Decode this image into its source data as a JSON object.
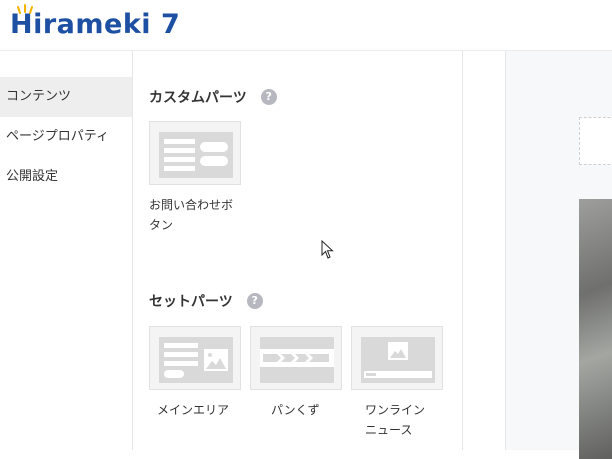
{
  "header": {
    "logo_text": "Hirameki 7"
  },
  "sidebar": {
    "items": [
      {
        "label": "コンテンツ",
        "active": true
      },
      {
        "label": "ページプロパティ",
        "active": false
      },
      {
        "label": "公開設定",
        "active": false
      }
    ]
  },
  "panel": {
    "custom_parts": {
      "title": "カスタムパーツ",
      "help": "?",
      "items": [
        {
          "label_line1": "お問い合わせボ",
          "label_line2": "タン",
          "icon": "contact-button-thumbnail"
        }
      ]
    },
    "set_parts": {
      "title": "セットパーツ",
      "help": "?",
      "items": [
        {
          "label_line1": "メインエリア",
          "label_line2": "",
          "icon": "main-area-thumbnail"
        },
        {
          "label_line1": "パンくず",
          "label_line2": "",
          "icon": "breadcrumb-thumbnail"
        },
        {
          "label_line1": "ワンライン",
          "label_line2": "ニュース",
          "icon": "one-line-news-thumbnail"
        }
      ]
    }
  },
  "colors": {
    "brand": "#1d4fa3",
    "spark": "#f2b400",
    "active_bg": "#eeeeee",
    "help_icon": "#b7b7bf",
    "thumb_fill": "#d9d9d9"
  }
}
